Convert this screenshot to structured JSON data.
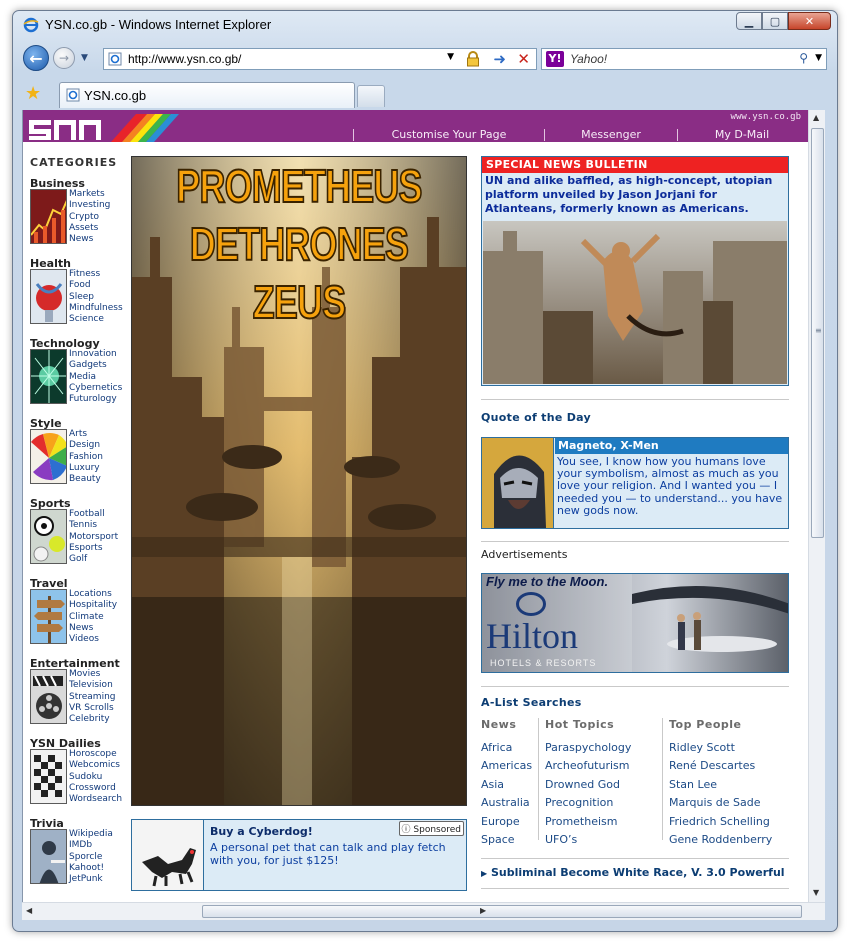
{
  "window": {
    "title": "YSN.co.gb - Windows Internet Explorer",
    "url": "http://www.ysn.co.gb/",
    "search_placeholder": "Yahoo!",
    "tab_label": "YSN.co.gb"
  },
  "header": {
    "logo": "YSN",
    "site_url": "www.ysn.co.gb",
    "nav": [
      "Customise Your Page",
      "Messenger",
      "My D-Mail"
    ]
  },
  "sidebar": {
    "heading": "CATEGORIES",
    "categories": [
      {
        "title": "Business",
        "links": [
          "Markets",
          "Investing",
          "Crypto",
          "Assets",
          "News"
        ]
      },
      {
        "title": "Health",
        "links": [
          "Fitness",
          "Food",
          "Sleep",
          "Mindfulness",
          "Science"
        ]
      },
      {
        "title": "Technology",
        "links": [
          "Innovation",
          "Gadgets",
          "Media",
          "Cybernetics",
          "Futurology"
        ]
      },
      {
        "title": "Style",
        "links": [
          "Arts",
          "Design",
          "Fashion",
          "Luxury",
          "Beauty"
        ]
      },
      {
        "title": "Sports",
        "links": [
          "Football",
          "Tennis",
          "Motorsport",
          "Esports",
          "Golf"
        ]
      },
      {
        "title": "Travel",
        "links": [
          "Locations",
          "Hospitality",
          "Climate",
          "News",
          "Videos"
        ]
      },
      {
        "title": "Entertainment",
        "links": [
          "Movies",
          "Television",
          "Streaming",
          "VR Scrolls",
          "Celebrity"
        ]
      },
      {
        "title": "YSN Dailies",
        "links": [
          "Horoscope",
          "Webcomics",
          "Sudoku",
          "Crossword",
          "Wordsearch"
        ]
      },
      {
        "title": "Trivia",
        "links": [
          "Wikipedia",
          "IMDb",
          "Sporcle",
          "Kahoot!",
          "JetPunk"
        ]
      }
    ]
  },
  "hero": {
    "line1": "PROMETHEUS",
    "line2": "DETHRONES ZEUS"
  },
  "sponsored": {
    "badge": "Sponsored",
    "title": "Buy a Cyberdog!",
    "text": "A personal pet that can talk and play fetch with you, for just $125!"
  },
  "bulletin": {
    "heading": "SPECIAL NEWS BULLETIN",
    "text": "UN and alike baffled, as high-concept, utopian platform unveiled by Jason Jorjani for Atlanteans, formerly known as Americans."
  },
  "quote": {
    "section_title": "Quote of the Day",
    "speaker": "Magneto, X-Men",
    "text": "You see, I know how you humans love your symbolism, almost as much as you love your religion. And I wanted you — I needed you — to understand... you have new gods now."
  },
  "ads": {
    "label": "Advertisements",
    "tagline": "Fly me to the Moon.",
    "brand": "Hilton",
    "brand_sub": "HOTELS & RESORTS"
  },
  "alist": {
    "title": "A-List Searches",
    "columns": [
      {
        "heading": "News",
        "items": [
          "Africa",
          "Americas",
          "Asia",
          "Australia",
          "Europe",
          "Space"
        ]
      },
      {
        "heading": "Hot Topics",
        "items": [
          "Paraspychology",
          "Archeofuturism",
          "Drowned God",
          "Precognition",
          "Prometheism",
          "UFO’s"
        ]
      },
      {
        "heading": "Top People",
        "items": [
          "Ridley Scott",
          "René Descartes",
          "Stan Lee",
          "Marquis de Sade",
          "Friedrich Schelling",
          "Gene Roddenberry"
        ]
      }
    ],
    "subliminal": "Subliminal Become White Race, V. 3.0 Powerful"
  },
  "colors": {
    "header_purple": "#8a2d85",
    "bulletin_red": "#ee2222",
    "panel_blue": "#dcebf6",
    "link_blue": "#11397a",
    "hero_orange": "#f6a20d"
  }
}
